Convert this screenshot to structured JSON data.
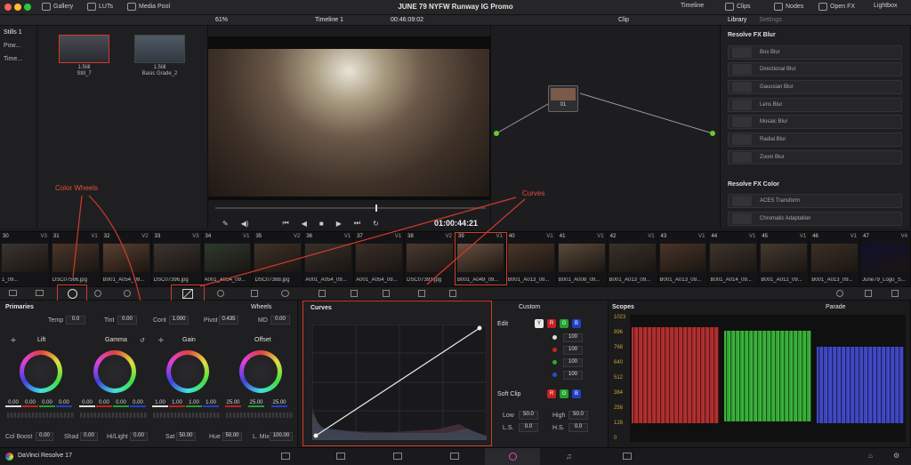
{
  "app": {
    "title": "JUNE 79 NYFW Runway IG Promo",
    "brand": "DaVinci Resolve 17"
  },
  "topbar": {
    "left": [
      "Gallery",
      "LUTs",
      "Media Pool"
    ],
    "right": [
      "Timeline",
      "Clips",
      "Nodes",
      "Open FX",
      "Lightbox"
    ]
  },
  "gallery": {
    "sidebar": [
      "Stills 1",
      "Pow...",
      "Time..."
    ],
    "stills": [
      {
        "id": "1.5till",
        "name": "Still_7"
      },
      {
        "id": "1.5till",
        "name": "Basic Grade_2"
      }
    ]
  },
  "viewer": {
    "zoom": "61%",
    "timeline": "Timeline 1",
    "timecode_top": "00:46:09:02",
    "timecode": "01:00:44:21"
  },
  "nodes": {
    "label": "Clip",
    "node_number": "01"
  },
  "library": {
    "tabs": [
      "Library",
      "Settings"
    ],
    "section1": "Resolve FX Blur",
    "blur": [
      "Box Blur",
      "Directional Blur",
      "Gaussian Blur",
      "Lens Blur",
      "Mosaic Blur",
      "Radial Blur",
      "Zoom Blur"
    ],
    "section2": "Resolve FX Color",
    "color": [
      "ACES Transform",
      "Chromatic Adaptation"
    ]
  },
  "clips": [
    {
      "n": "30",
      "t": "V3",
      "label": "1_09...",
      "c": "#3a3530"
    },
    {
      "n": "31",
      "t": "V1",
      "label": "DSC07566.jpg",
      "c": "#4a3628"
    },
    {
      "n": "32",
      "t": "V2",
      "label": "B001_A054_09...",
      "c": "#5a4030"
    },
    {
      "n": "33",
      "t": "V3",
      "label": "DSC07396.jpg",
      "c": "#3c3430"
    },
    {
      "n": "34",
      "t": "V1",
      "label": "A001_A054_09...",
      "c": "#2e3a2e"
    },
    {
      "n": "35",
      "t": "V2",
      "label": "DSC07388.jpg",
      "c": "#403228"
    },
    {
      "n": "36",
      "t": "V1",
      "label": "A001_A054_09...",
      "c": "#38302a"
    },
    {
      "n": "37",
      "t": "V1",
      "label": "A001_A054_09...",
      "c": "#3a2e28"
    },
    {
      "n": "38",
      "t": "V2",
      "label": "DSC07393.jpg",
      "c": "#4a3a30"
    },
    {
      "n": "39",
      "t": "V1",
      "label": "B001_A049_09...",
      "c": "#6a5040"
    },
    {
      "n": "40",
      "t": "V1",
      "label": "B001_A013_09...",
      "c": "#4a3628"
    },
    {
      "n": "41",
      "t": "V1",
      "label": "B001_A008_09...",
      "c": "#5a4a3a"
    },
    {
      "n": "42",
      "t": "V1",
      "label": "B001_A013_09...",
      "c": "#3a3228"
    },
    {
      "n": "43",
      "t": "V1",
      "label": "B001_A013_09...",
      "c": "#4a3428"
    },
    {
      "n": "44",
      "t": "V1",
      "label": "B001_A014_09...",
      "c": "#3e342c"
    },
    {
      "n": "45",
      "t": "V1",
      "label": "B001_A012_09...",
      "c": "#443a30"
    },
    {
      "n": "46",
      "t": "V1",
      "label": "B001_A013_09...",
      "c": "#3c3026"
    },
    {
      "n": "47",
      "t": "V4",
      "label": "June79_Logo_S...",
      "c": "#101030"
    }
  ],
  "annotations": {
    "wheels": "Color Wheels",
    "curves": "Curves"
  },
  "primaries": {
    "title": "Primaries",
    "mode": "Wheels",
    "temp_label": "Temp",
    "temp": "0.0",
    "tint_label": "Tint",
    "tint": "0.00",
    "cont_label": "Cont",
    "cont": "1.000",
    "pivot_label": "Pivot",
    "pivot": "0.435",
    "md_label": "MD",
    "md": "0.00",
    "wheels": [
      {
        "name": "Lift",
        "values": [
          "0.00",
          "0.00",
          "0.00",
          "0.00"
        ]
      },
      {
        "name": "Gamma",
        "values": [
          "0.00",
          "0.00",
          "0.00",
          "0.00"
        ]
      },
      {
        "name": "Gain",
        "values": [
          "1.00",
          "1.00",
          "1.00",
          "1.00"
        ]
      },
      {
        "name": "Offset",
        "values": [
          "25.00",
          "25.00",
          "25.00"
        ]
      }
    ],
    "colboost_label": "Col Boost",
    "colboost": "0.00",
    "shad_label": "Shad",
    "shad": "0.00",
    "hilight_label": "Hi/Light",
    "hilight": "0.00",
    "sat_label": "Sat",
    "sat": "50.00",
    "hue_label": "Hue",
    "hue": "50.00",
    "lmix_label": "L. Mix",
    "lmix": "100.00"
  },
  "curves": {
    "title": "Curves",
    "mode": "Custom",
    "edit_label": "Edit",
    "channels": [
      "Y",
      "R",
      "G",
      "B"
    ],
    "intensity": [
      "100",
      "100",
      "100",
      "100"
    ],
    "softclip_label": "Soft Clip",
    "low_label": "Low",
    "low": "50.0",
    "high_label": "High",
    "high": "50.0",
    "ls_label": "L.S.",
    "ls": "0.0",
    "hs_label": "H.S.",
    "hs": "0.0"
  },
  "scopes": {
    "title": "Scopes",
    "mode": "Parade",
    "levels": [
      "1023",
      "896",
      "768",
      "640",
      "512",
      "384",
      "256",
      "128",
      "0"
    ]
  }
}
